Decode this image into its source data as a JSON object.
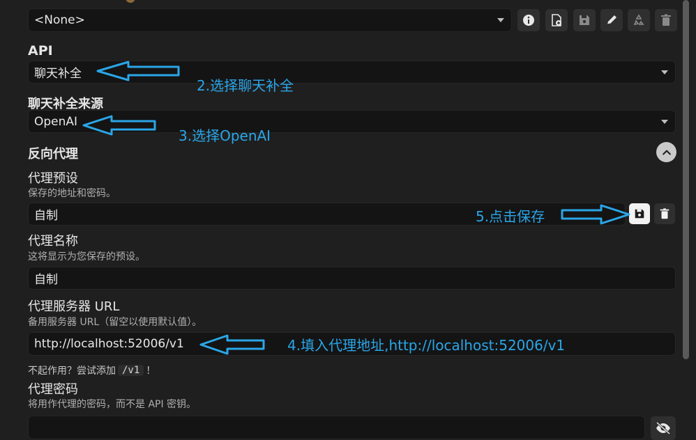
{
  "connection": {
    "preset_value": "<None>"
  },
  "api": {
    "label": "API",
    "value": "聊天补全"
  },
  "source": {
    "label": "聊天补全来源",
    "value": "OpenAI"
  },
  "reverse_proxy": {
    "title": "反向代理",
    "preset_label": "代理预设",
    "preset_hint": "保存的地址和密码。",
    "preset_value": "自制",
    "name_label": "代理名称",
    "name_hint": "这将显示为您保存的预设。",
    "name_value": "自制",
    "url_label": "代理服务器 URL",
    "url_hint": "备用服务器 URL（留空以使用默认值）。",
    "url_value": "http://localhost:52006/v1",
    "tip_prefix": "不起作用？尝试添加",
    "tip_code": "/v1",
    "tip_suffix": "！",
    "password_label": "代理密码",
    "password_hint": "将用作代理的密码，而不是 API 密钥。",
    "password_value": ""
  },
  "annotations": {
    "step2": "2.选择聊天补全",
    "step3": "3.选择OpenAI",
    "step4": "4.填入代理地址,http://localhost:52006/v1",
    "step5": "5.点击保存"
  },
  "colors": {
    "annotation": "#2aa6e8",
    "background": "#1f1f1f",
    "field": "#141414"
  }
}
